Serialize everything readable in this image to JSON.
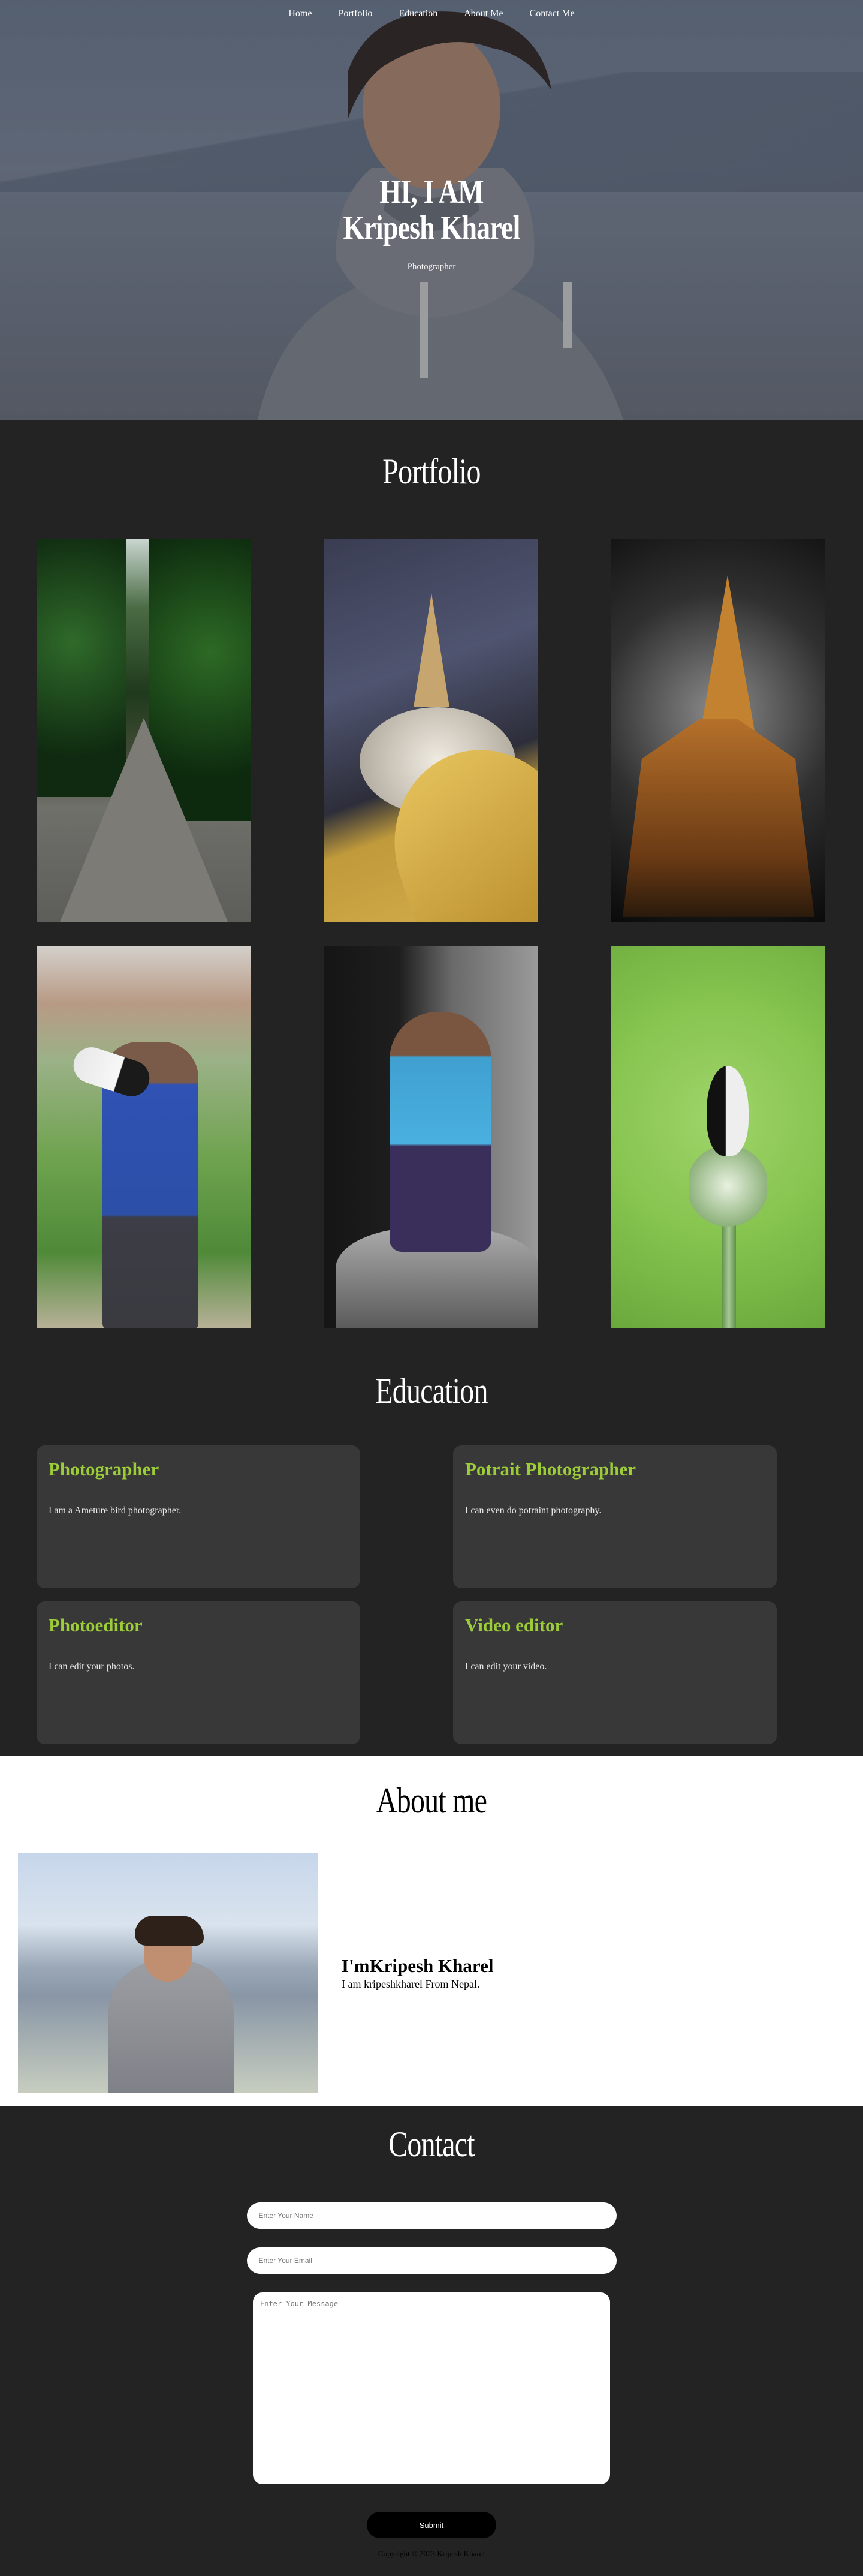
{
  "nav": {
    "items": [
      "Home",
      "Portfolio",
      "Education",
      "About Me",
      "Contact Me"
    ]
  },
  "hero": {
    "line1": "HI, I AM",
    "line2": "Kripesh Kharel",
    "subtitle": "Photographer"
  },
  "portfolio": {
    "title": "Portfolio"
  },
  "education": {
    "title": "Education",
    "cards": [
      {
        "title": "Photographer",
        "text": "I am a Ameture bird photographer."
      },
      {
        "title": "Potrait Photographer",
        "text": "I can even do potraint photography."
      },
      {
        "title": "Photoeditor",
        "text": "I can edit your photos."
      },
      {
        "title": "Video editor",
        "text": "I can edit your video."
      }
    ],
    "accent_color": "#9ccc38"
  },
  "about": {
    "title": "About me",
    "heading": "I'mKripesh Kharel",
    "text": "I am kripeshkharel From Nepal."
  },
  "contact": {
    "title": "Contact",
    "name_placeholder": "Enter Your Name",
    "email_placeholder": "Enter Your Email",
    "message_placeholder": "Enter Your Message",
    "submit_label": "Submit",
    "copyright": "Copyright © 2023 Kripesh Kharel"
  },
  "colors": {
    "background": "#232323",
    "card": "#383838",
    "accent": "#9ccc38"
  }
}
